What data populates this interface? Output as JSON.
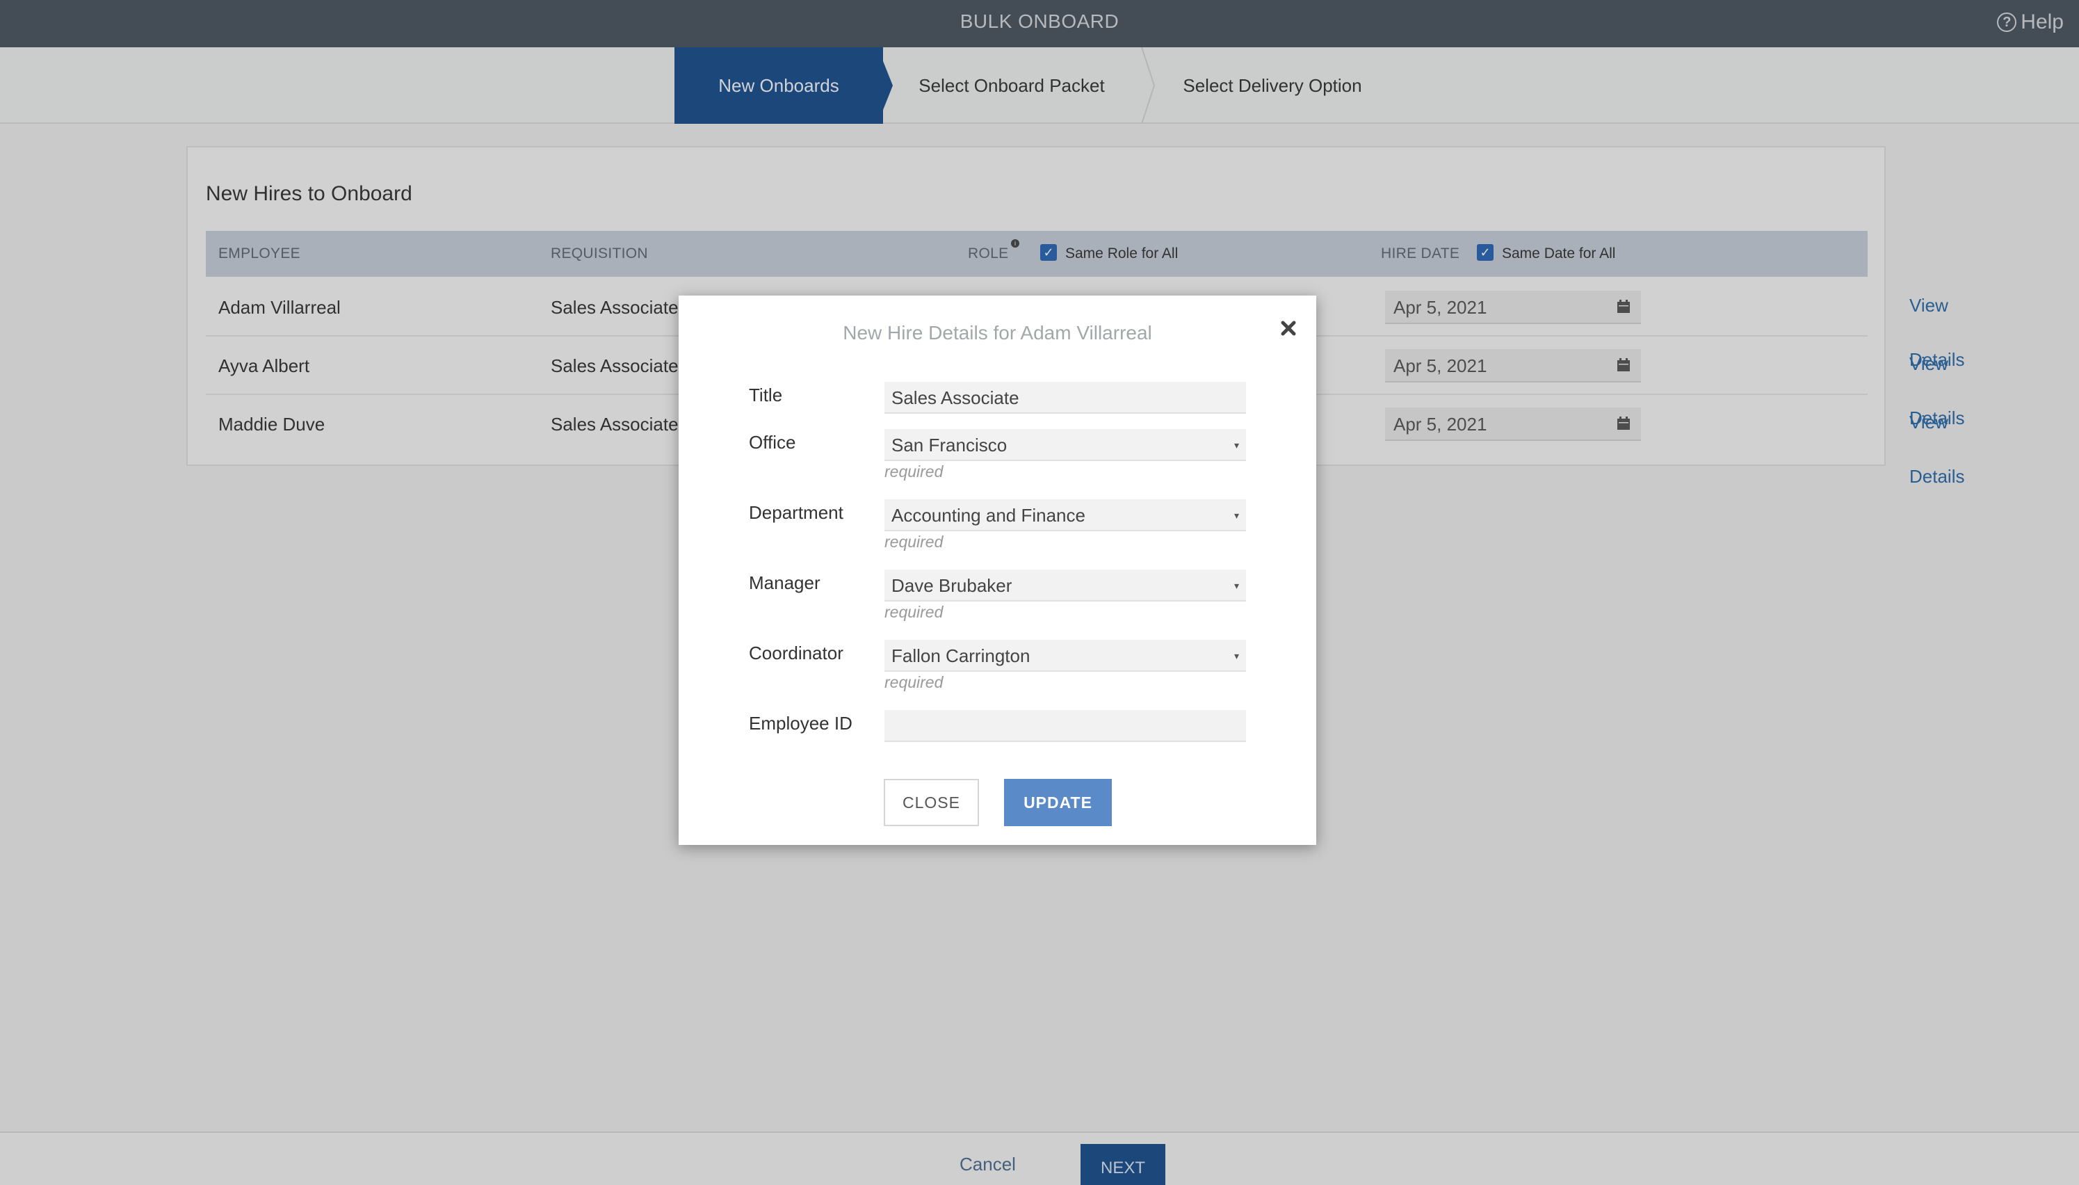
{
  "header": {
    "title": "BULK ONBOARD",
    "help_label": "Help",
    "help_icon_glyph": "?"
  },
  "stepper": {
    "steps": [
      {
        "label": "New Onboards",
        "active": true
      },
      {
        "label": "Select Onboard Packet",
        "active": false
      },
      {
        "label": "Select Delivery Option",
        "active": false
      }
    ]
  },
  "card": {
    "title": "New Hires to Onboard",
    "columns": {
      "employee": "EMPLOYEE",
      "requisition": "REQUISITION",
      "role": "ROLE",
      "hire_date": "HIRE DATE"
    },
    "same_role_label": "Same Role for All",
    "same_role_checked": true,
    "same_date_label": "Same Date for All",
    "same_date_checked": true,
    "check_glyph": "✓",
    "role_info_glyph": "i",
    "role_caret": "▾",
    "view_details_label": "View Details",
    "rows": [
      {
        "employee": "Adam Villarreal",
        "requisition": "Sales Associate",
        "hire_date": "Apr 5, 2021"
      },
      {
        "employee": "Ayva Albert",
        "requisition": "Sales Associate",
        "hire_date": "Apr 5, 2021"
      },
      {
        "employee": "Maddie Duve",
        "requisition": "Sales Associate",
        "hire_date": "Apr 5, 2021"
      }
    ]
  },
  "modal": {
    "title": "New Hire Details for Adam Villarreal",
    "fields": {
      "title": {
        "label": "Title",
        "value": "Sales Associate"
      },
      "office": {
        "label": "Office",
        "value": "San Francisco",
        "hint": "required"
      },
      "department": {
        "label": "Department",
        "value": "Accounting and Finance",
        "hint": "required"
      },
      "manager": {
        "label": "Manager",
        "value": "Dave Brubaker",
        "hint": "required"
      },
      "coordinator": {
        "label": "Coordinator",
        "value": "Fallon Carrington",
        "hint": "required"
      },
      "employee_id": {
        "label": "Employee ID",
        "value": ""
      }
    },
    "dropdown_caret": "▾",
    "close_label": "CLOSE",
    "update_label": "UPDATE"
  },
  "footer": {
    "cancel_label": "Cancel",
    "next_label": "NEXT"
  },
  "colors": {
    "topbar": "#4a5360",
    "accent": "#1a4e8c",
    "update_button": "#5b8ac9",
    "link": "#2a69a8",
    "table_header": "#c3ccd7"
  }
}
